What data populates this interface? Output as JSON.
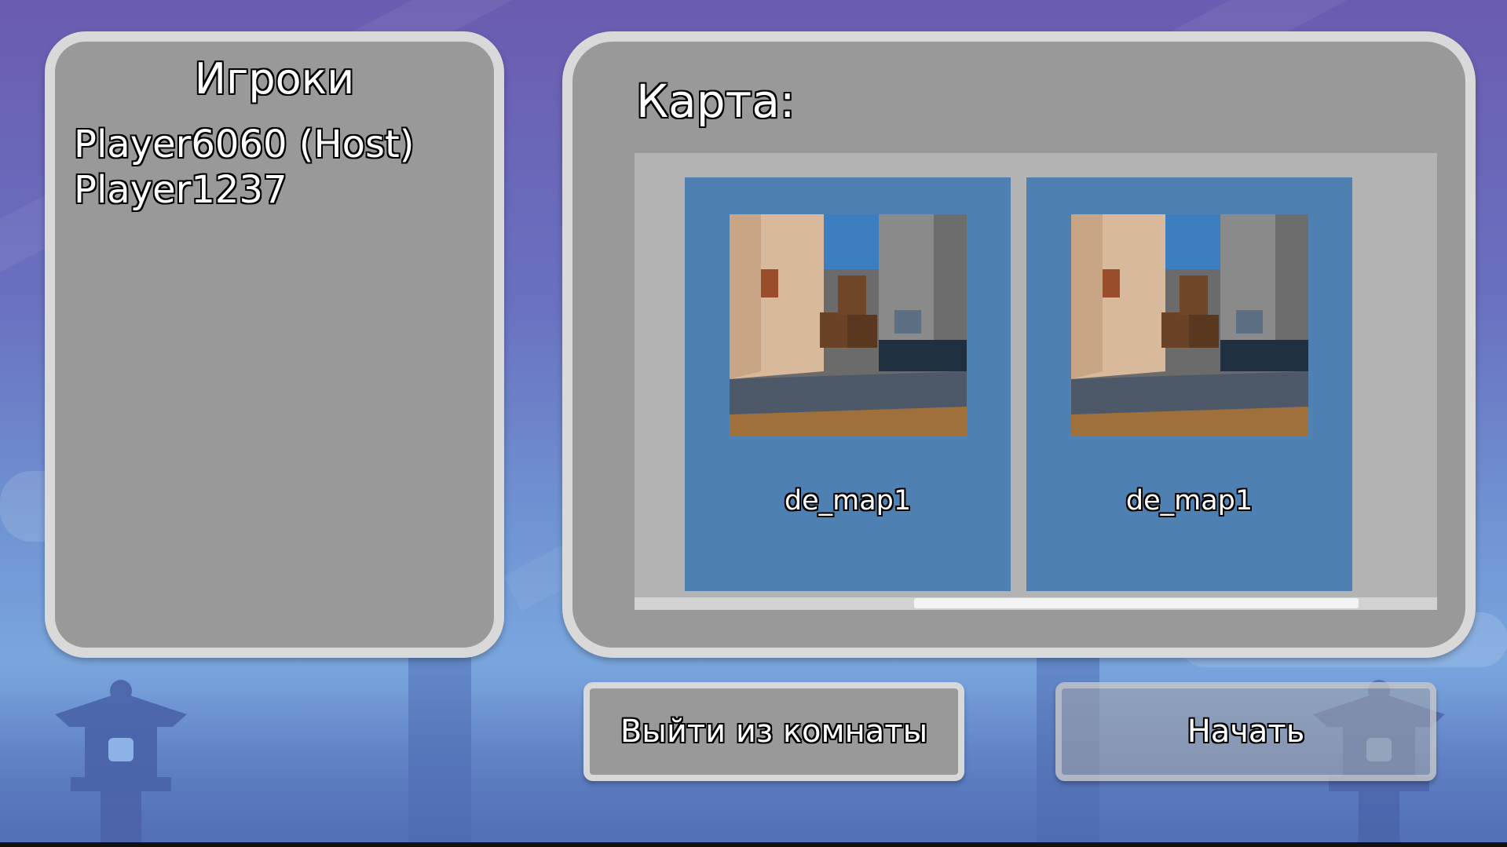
{
  "players_panel": {
    "title": "Игроки",
    "players": [
      "Player6060 (Host)",
      "Player1237"
    ]
  },
  "map_panel": {
    "title": "Карта:",
    "maps": [
      {
        "name": "de_map1",
        "thumbnail": "map-preview-image"
      },
      {
        "name": "de_map1",
        "thumbnail": "map-preview-image"
      }
    ]
  },
  "buttons": {
    "leave_label": "Выйти из комнаты",
    "start_label": "Начать"
  },
  "colors": {
    "panel": "#999999",
    "panel_border": "#d9d9d9",
    "map_card": "#4e81b1",
    "map_scroll_area": "#b3b3b3"
  }
}
